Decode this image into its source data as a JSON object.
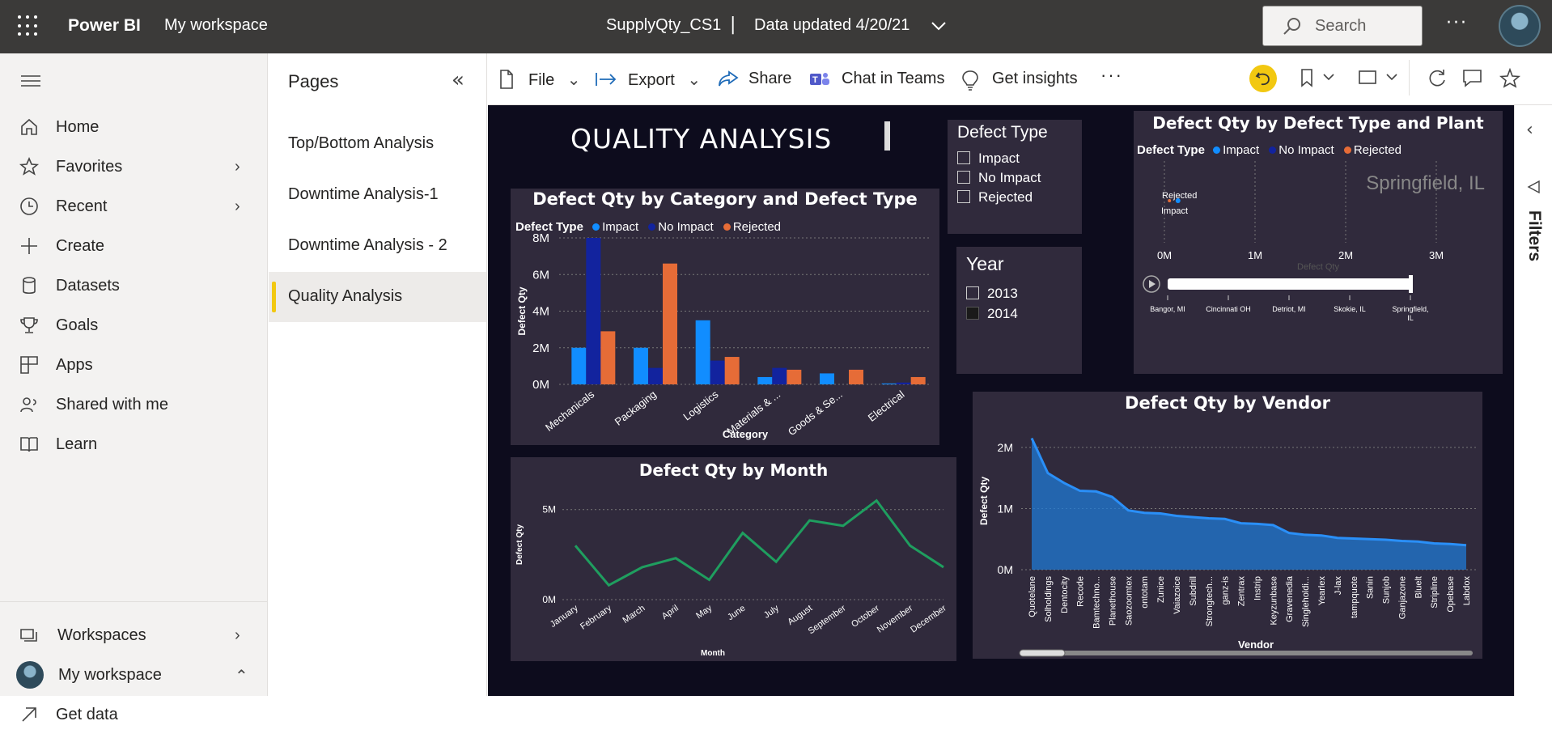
{
  "topbar": {
    "brand": "Power BI",
    "workspace": "My workspace",
    "report_name": "SupplyQty_CS1",
    "separator": "|",
    "data_updated": "Data updated 4/20/21",
    "search_placeholder": "Search",
    "more": "···"
  },
  "leftnav": {
    "items": [
      {
        "label": "Home",
        "icon": "home-icon"
      },
      {
        "label": "Favorites",
        "icon": "star-icon"
      },
      {
        "label": "Recent",
        "icon": "clock-icon"
      },
      {
        "label": "Create",
        "icon": "plus-icon"
      },
      {
        "label": "Datasets",
        "icon": "database-icon"
      },
      {
        "label": "Goals",
        "icon": "trophy-icon"
      },
      {
        "label": "Apps",
        "icon": "apps-icon"
      },
      {
        "label": "Shared with me",
        "icon": "shared-icon"
      },
      {
        "label": "Learn",
        "icon": "book-icon"
      },
      {
        "label": "Workspaces",
        "icon": "workspaces-icon"
      },
      {
        "label": "My workspace",
        "icon": "avatar"
      },
      {
        "label": "Get data",
        "icon": "arrow-up-right-icon"
      }
    ]
  },
  "pages": {
    "title": "Pages",
    "items": [
      "Top/Bottom Analysis",
      "Downtime Analysis-1",
      "Downtime Analysis - 2",
      "Quality Analysis"
    ],
    "active": "Quality Analysis"
  },
  "toolbar": {
    "file": "File",
    "export": "Export",
    "share": "Share",
    "chat": "Chat in Teams",
    "insights": "Get insights",
    "more": "···"
  },
  "rightpane": {
    "filters": "Filters"
  },
  "report": {
    "heading": "QUALITY ANALYSIS",
    "colors": {
      "impact": "#118dff",
      "no_impact": "#12239e",
      "rejected": "#e66c37",
      "line": "#1f9e5f",
      "area": "#1f7ad4"
    },
    "slicer_defect": {
      "title": "Defect Type",
      "options": [
        "Impact",
        "No Impact",
        "Rejected"
      ]
    },
    "slicer_year": {
      "title": "Year",
      "options": [
        "2013",
        "2014"
      ]
    },
    "legend_label": "Defect Type",
    "legend_items": [
      "Impact",
      "No Impact",
      "Rejected"
    ]
  },
  "chart_data": [
    {
      "type": "bar",
      "title": "Defect Qty by Category and Defect Type",
      "xlabel": "Category",
      "ylabel": "Defect Qty",
      "ylim": [
        0,
        8000000
      ],
      "yticks": [
        "0M",
        "2M",
        "4M",
        "6M",
        "8M"
      ],
      "categories": [
        "Mechanicals",
        "Packaging",
        "Logistics",
        "Materials & ...",
        "Goods & Se...",
        "Electrical"
      ],
      "series": [
        {
          "name": "Impact",
          "values": [
            2000000,
            2000000,
            3500000,
            400000,
            600000,
            50000
          ]
        },
        {
          "name": "No Impact",
          "values": [
            8000000,
            900000,
            1300000,
            900000,
            0,
            100000
          ]
        },
        {
          "name": "Rejected",
          "values": [
            2900000,
            6600000,
            1500000,
            800000,
            800000,
            400000
          ]
        }
      ]
    },
    {
      "type": "line",
      "title": "Defect Qty by Month",
      "xlabel": "Month",
      "ylabel": "Defect Qty",
      "ylim": [
        0,
        6200000
      ],
      "yticks": [
        "0M",
        "5M"
      ],
      "categories": [
        "January",
        "February",
        "March",
        "April",
        "May",
        "June",
        "July",
        "August",
        "September",
        "October",
        "November",
        "December"
      ],
      "values": [
        3000000,
        800000,
        1800000,
        2300000,
        1100000,
        3700000,
        2100000,
        4400000,
        4100000,
        5500000,
        3000000,
        1800000
      ]
    },
    {
      "type": "area",
      "title": "Defect Qty by Vendor",
      "xlabel": "Vendor",
      "ylabel": "Defect Qty",
      "ylim": [
        0,
        2250000
      ],
      "yticks": [
        "0M",
        "1M",
        "2M"
      ],
      "categories": [
        "Quotelane",
        "Solholdings",
        "Dentocity",
        "Recode",
        "Bamtechno...",
        "Planethouse",
        "Saozoomtex",
        "ontotam",
        "Zunice",
        "Vaiazoice",
        "Subdrill",
        "Strongtech...",
        "ganz-is",
        "Zentrax",
        "Instrip",
        "Keyzunbase",
        "Gravenedia",
        "Singleholdi...",
        "Yearlex",
        "J-lax",
        "tampquote",
        "Sanin",
        "Sunjob",
        "Ganjazone",
        "Bluelt",
        "Stripline",
        "Opebase",
        "Labdox"
      ],
      "values": [
        2150000,
        1580000,
        1420000,
        1290000,
        1280000,
        1190000,
        970000,
        930000,
        920000,
        880000,
        860000,
        840000,
        830000,
        760000,
        750000,
        730000,
        600000,
        570000,
        560000,
        520000,
        510000,
        500000,
        490000,
        470000,
        460000,
        430000,
        420000,
        400000
      ]
    },
    {
      "type": "scatter",
      "title": "Defect Qty by Defect Type and Plant",
      "xlabel": "Defect Qty",
      "xlim": [
        0,
        3500000
      ],
      "xticks": [
        "0M",
        "1M",
        "2M",
        "3M"
      ],
      "play_axis_label": "Springfield, IL",
      "points": [
        {
          "name": "Rejected",
          "x": 100000
        },
        {
          "name": "Impact",
          "x": 150000
        }
      ],
      "play_axis": [
        "Bangor, MI",
        "Cincinnati OH",
        "Detriot, MI",
        "Skokie, IL",
        "Springfield, IL"
      ]
    }
  ]
}
